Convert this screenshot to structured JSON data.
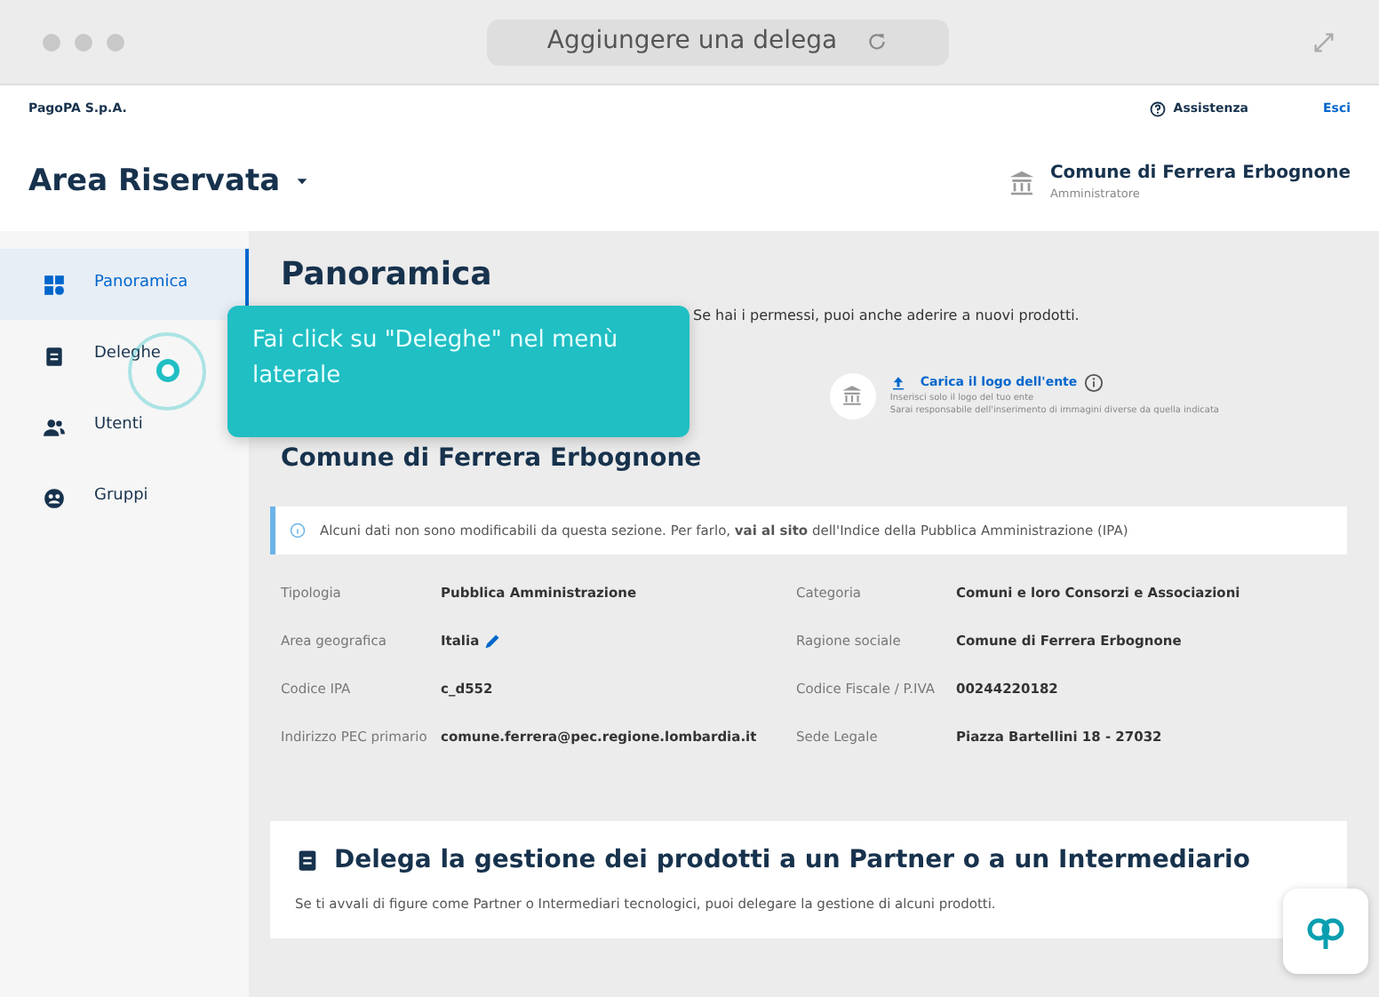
{
  "window": {
    "title": "Aggiungere una delega"
  },
  "top_bar": {
    "brand": "PagoPA S.p.A.",
    "help": "Assistenza",
    "logout": "Esci"
  },
  "header": {
    "title": "Area Riservata",
    "entity": "Comune di Ferrera Erbognone",
    "role": "Amministratore"
  },
  "sidebar": {
    "items": [
      {
        "label": "Panoramica",
        "selected": true
      },
      {
        "label": "Deleghe",
        "selected": false
      },
      {
        "label": "Utenti",
        "selected": false
      },
      {
        "label": "Gruppi",
        "selected": false
      }
    ]
  },
  "page": {
    "title": "Panoramica",
    "subtitle": "Se hai i permessi, puoi anche aderire a nuovi prodotti.",
    "entity_title": "Comune di Ferrera Erbognone",
    "logo": {
      "link": "Carica il logo dell'ente",
      "hint_1": "Inserisci solo il logo del tuo ente",
      "hint_2": "Sarai responsabile dell'inserimento di immagini diverse da quella indicata"
    },
    "alert": {
      "before": "Alcuni dati non sono modificabili da questa sezione. Per farlo,",
      "link": "vai al sito",
      "after": "dell'Indice della Pubblica Amministrazione (IPA)"
    },
    "details": [
      [
        {
          "label": "Tipologia",
          "value": "Pubblica Amministrazione",
          "editable": false
        },
        {
          "label": "Categoria",
          "value": "Comuni e loro Consorzi e Associazioni",
          "editable": false
        }
      ],
      [
        {
          "label": "Area geografica",
          "value": "Italia",
          "editable": true
        },
        {
          "label": "Ragione sociale",
          "value": "Comune di Ferrera Erbognone",
          "editable": false
        }
      ],
      [
        {
          "label": "Codice IPA",
          "value": "c_d552",
          "editable": false
        },
        {
          "label": "Codice Fiscale / P.IVA",
          "value": "00244220182",
          "editable": false
        }
      ],
      [
        {
          "label": "Indirizzo PEC primario",
          "value": "comune.ferrera@pec.regione.lombardia.it",
          "editable": false
        },
        {
          "label": "Sede Legale",
          "value": "Piazza Bartellini 18 - 27032",
          "editable": false
        }
      ]
    ],
    "delegation": {
      "title": "Delega la gestione dei prodotti a un Partner o a un Intermediario",
      "text": "Se ti avvali di figure come Partner o Intermediari tecnologici, puoi delegare la gestione di alcuni prodotti."
    }
  },
  "tooltip": {
    "text": "Fai click su \"Deleghe\" nel menù laterale"
  }
}
